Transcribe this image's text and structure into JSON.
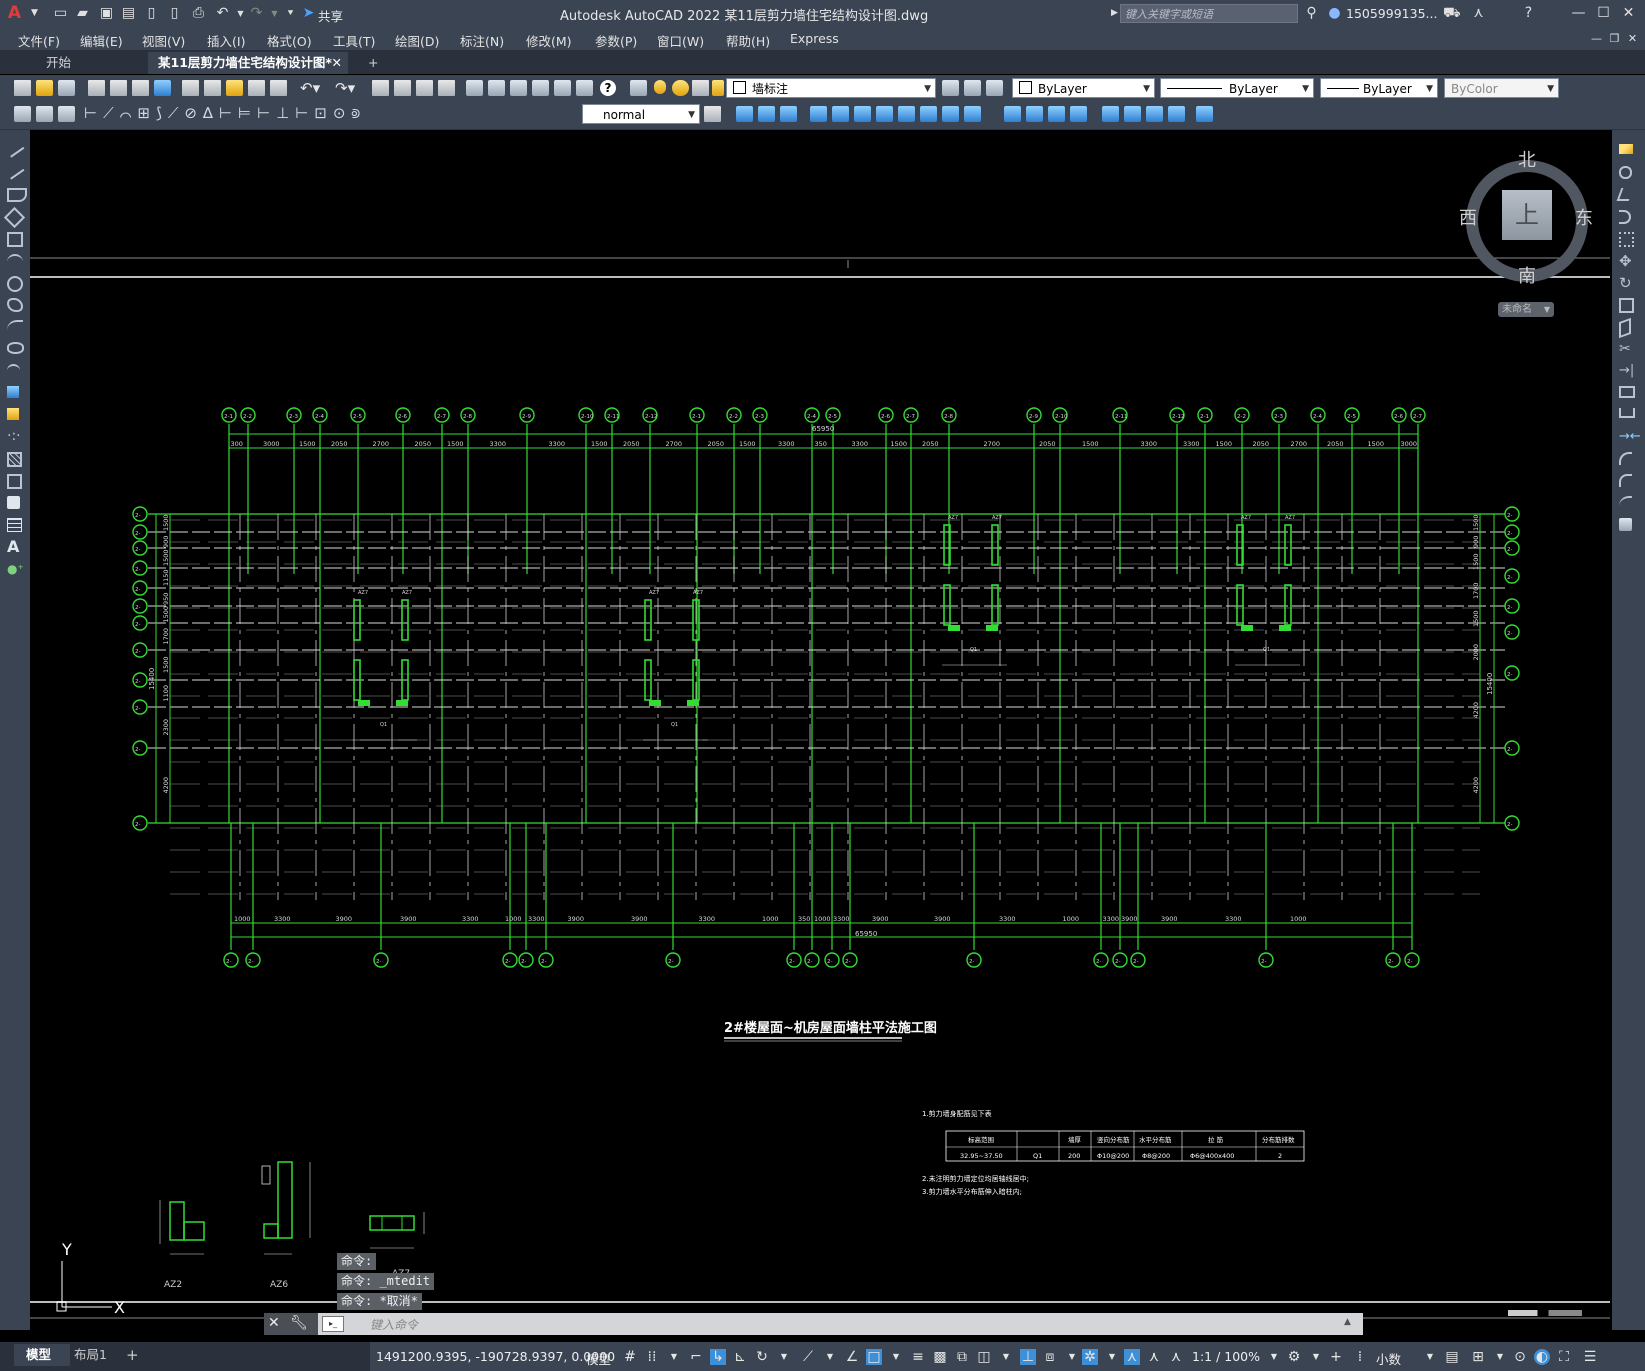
{
  "app": {
    "title": "Autodesk AutoCAD 2022   某11层剪力墙住宅结构设计图.dwg",
    "search_placeholder": "键入关键字或短语",
    "user": "1505999135...",
    "share_label": "共享"
  },
  "menu": [
    "文件(F)",
    "编辑(E)",
    "视图(V)",
    "插入(I)",
    "格式(O)",
    "工具(T)",
    "绘图(D)",
    "标注(N)",
    "修改(M)",
    "参数(P)",
    "窗口(W)",
    "帮助(H)",
    "Express"
  ],
  "tabs": [
    {
      "label": "开始"
    },
    {
      "label": "某11层剪力墙住宅结构设计图*"
    }
  ],
  "toolbar": {
    "layer": "墙标注",
    "color": "ByLayer",
    "linetype": "ByLayer",
    "lineweight": "ByLayer",
    "plotstyle": "ByColor",
    "textstyle": "normal"
  },
  "viewcube": {
    "north": "北",
    "south": "南",
    "east": "东",
    "west": "西",
    "top": "上",
    "ucs": "未命名"
  },
  "drawing": {
    "title": "2#楼屋面~机房屋面墙柱平法施工图",
    "top_total": "65950",
    "bottom_total": "65950",
    "left_total": "15400",
    "right_total": "15400",
    "top_dims": [
      "300",
      "3000",
      "1500",
      "2050",
      "2700",
      "2050",
      "1500",
      "3300",
      "3300",
      "1500",
      "2050",
      "2700",
      "2050",
      "1500",
      "3300",
      "350",
      "3300",
      "1500",
      "2050",
      "2700",
      "2050",
      "1500",
      "3300",
      "3300",
      "1500",
      "2050",
      "2700",
      "2050",
      "1500",
      "3000",
      "300"
    ],
    "bottom_dims": [
      "1000",
      "3300",
      "3900",
      "3900",
      "3300",
      "1000",
      "3300",
      "3900",
      "3900",
      "3300",
      "1000",
      "350",
      "1000",
      "3300",
      "3900",
      "3900",
      "3300",
      "1000",
      "3300",
      "3900",
      "3900",
      "3300",
      "1000"
    ],
    "left_dims": [
      "1500",
      "900",
      "1500",
      "1150",
      "950",
      "1500",
      "1700",
      "1500",
      "1100",
      "2300",
      "4200"
    ],
    "right_dims": [
      "1500",
      "900",
      "1500",
      "1700",
      "1500",
      "2000",
      "4200",
      "4200"
    ],
    "axis_label_top": [
      "2-1",
      "2-2",
      "2-3",
      "2-4",
      "2-5",
      "2-6",
      "2-7",
      "2-8",
      "2-9",
      "2-10",
      "2-11",
      "2-12"
    ],
    "notes": {
      "n1": "1.剪力墙身配筋见下表",
      "n2": "2.未注明剪力墙定位均居轴线居中;",
      "n3": "3.剪力墙水平分布筋伸入暗柱内;",
      "headers": [
        "标高范围",
        "",
        "墙厚",
        "竖向分布筋",
        "水平分布筋",
        "拉 筋",
        "分布筋排数"
      ],
      "row": [
        "32.95~37.50",
        "Q1",
        "200",
        "Φ10@200",
        "Φ8@200",
        "Φ6@400x400",
        "2"
      ]
    },
    "details": [
      {
        "name": "AZ2"
      },
      {
        "name": "AZ6"
      },
      {
        "name": "AZ7"
      }
    ]
  },
  "ucs": {
    "y_label": "Y",
    "x_label": "X"
  },
  "commands": [
    "命令:",
    "命令: _mtedit",
    "命令: *取消*"
  ],
  "command_placeholder": "键入命令",
  "layout_tabs": [
    "模型",
    "布局1"
  ],
  "status": {
    "coords": "1491200.9395, -190728.9397, 0.0000",
    "model": "模型",
    "scale": "1:1 / 100%",
    "units": "小数"
  }
}
